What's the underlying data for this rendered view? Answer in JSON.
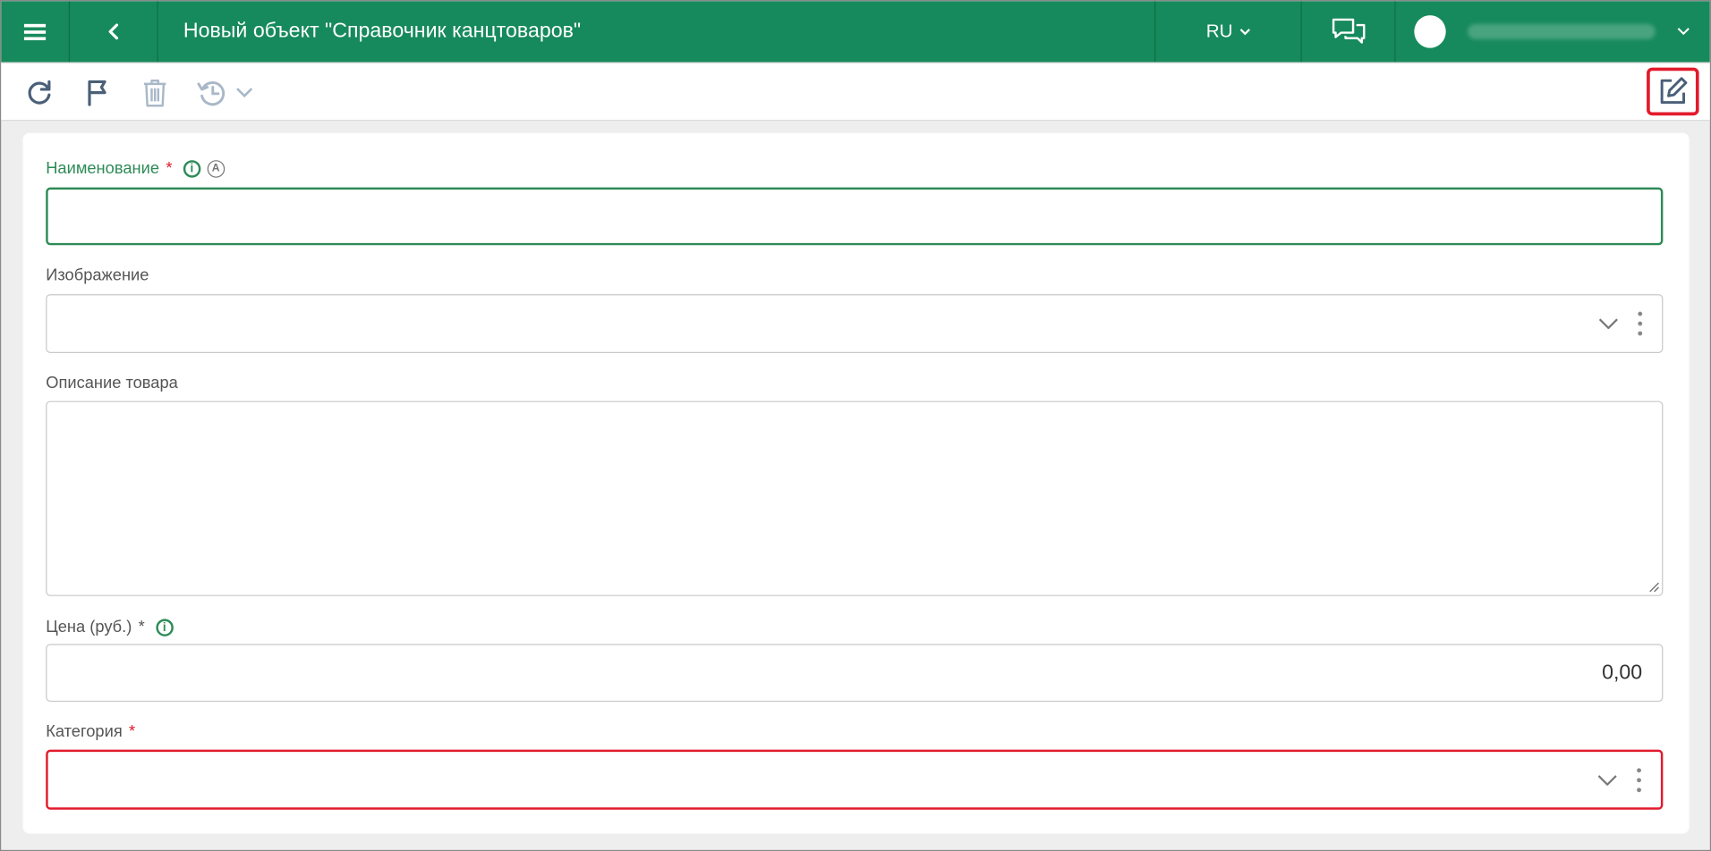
{
  "header": {
    "title": "Новый объект \"Справочник канцтоваров\"",
    "language": "RU",
    "icons": {
      "menu": "hamburger-icon",
      "back": "chevron-left-icon",
      "chat": "chat-icon",
      "user": "avatar"
    }
  },
  "toolbar": {
    "icons": [
      "refresh-icon",
      "flag-icon",
      "trash-icon",
      "history-icon",
      "edit-icon"
    ]
  },
  "form": {
    "name": {
      "label": "Наименование",
      "required_mark": "*",
      "value": ""
    },
    "image": {
      "label": "Изображение",
      "value": ""
    },
    "description": {
      "label": "Описание товара",
      "value": ""
    },
    "price": {
      "label": "Цена (руб.)",
      "required_mark": "*",
      "value": "0,00"
    },
    "category": {
      "label": "Категория",
      "required_mark": "*",
      "value": ""
    }
  },
  "colors": {
    "brand_green": "#168a5c",
    "accent_green": "#2e8b57",
    "error_red": "#e21b2c"
  }
}
